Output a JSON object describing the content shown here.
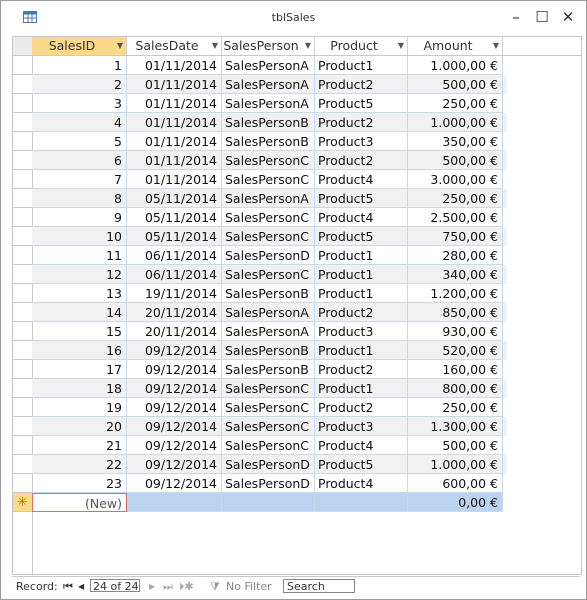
{
  "window": {
    "title": "tblSales",
    "minimize": "–",
    "maximize": "☐",
    "close": "✕"
  },
  "columns": [
    {
      "label": "SalesID"
    },
    {
      "label": "SalesDate"
    },
    {
      "label": "SalesPerson"
    },
    {
      "label": "Product"
    },
    {
      "label": "Amount"
    }
  ],
  "rows": [
    [
      "1",
      "01/11/2014",
      "SalesPersonA",
      "Product1",
      "1.000,00 €"
    ],
    [
      "2",
      "01/11/2014",
      "SalesPersonA",
      "Product2",
      "500,00 €"
    ],
    [
      "3",
      "01/11/2014",
      "SalesPersonA",
      "Product5",
      "250,00 €"
    ],
    [
      "4",
      "01/11/2014",
      "SalesPersonB",
      "Product2",
      "1.000,00 €"
    ],
    [
      "5",
      "01/11/2014",
      "SalesPersonB",
      "Product3",
      "350,00 €"
    ],
    [
      "6",
      "01/11/2014",
      "SalesPersonC",
      "Product2",
      "500,00 €"
    ],
    [
      "7",
      "01/11/2014",
      "SalesPersonC",
      "Product4",
      "3.000,00 €"
    ],
    [
      "8",
      "05/11/2014",
      "SalesPersonA",
      "Product5",
      "250,00 €"
    ],
    [
      "9",
      "05/11/2014",
      "SalesPersonC",
      "Product4",
      "2.500,00 €"
    ],
    [
      "10",
      "05/11/2014",
      "SalesPersonC",
      "Product5",
      "750,00 €"
    ],
    [
      "11",
      "06/11/2014",
      "SalesPersonD",
      "Product1",
      "280,00 €"
    ],
    [
      "12",
      "06/11/2014",
      "SalesPersonC",
      "Product1",
      "340,00 €"
    ],
    [
      "13",
      "19/11/2014",
      "SalesPersonB",
      "Product1",
      "1.200,00 €"
    ],
    [
      "14",
      "20/11/2014",
      "SalesPersonA",
      "Product2",
      "850,00 €"
    ],
    [
      "15",
      "20/11/2014",
      "SalesPersonA",
      "Product3",
      "930,00 €"
    ],
    [
      "16",
      "09/12/2014",
      "SalesPersonB",
      "Product1",
      "520,00 €"
    ],
    [
      "17",
      "09/12/2014",
      "SalesPersonB",
      "Product2",
      "160,00 €"
    ],
    [
      "18",
      "09/12/2014",
      "SalesPersonC",
      "Product1",
      "800,00 €"
    ],
    [
      "19",
      "09/12/2014",
      "SalesPersonC",
      "Product2",
      "250,00 €"
    ],
    [
      "20",
      "09/12/2014",
      "SalesPersonC",
      "Product3",
      "1.300,00 €"
    ],
    [
      "21",
      "09/12/2014",
      "SalesPersonC",
      "Product4",
      "500,00 €"
    ],
    [
      "22",
      "09/12/2014",
      "SalesPersonD",
      "Product5",
      "1.000,00 €"
    ],
    [
      "23",
      "09/12/2014",
      "SalesPersonD",
      "Product4",
      "600,00 €"
    ]
  ],
  "new_row": {
    "marker": "✳",
    "id": "(New)",
    "amount": "0,00 €"
  },
  "navigation": {
    "record_label": "Record:",
    "record_value": "24 of 24",
    "filter_label": "No Filter",
    "search_placeholder": "Search"
  }
}
